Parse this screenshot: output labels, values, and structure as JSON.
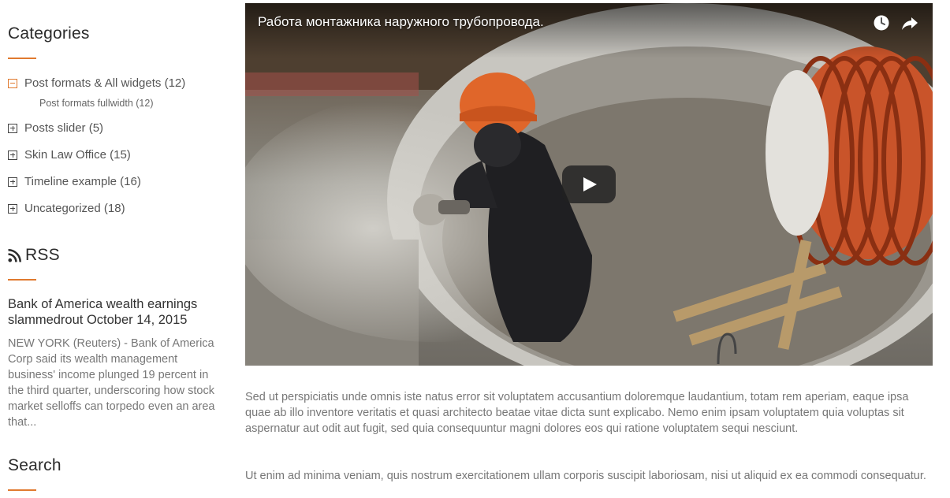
{
  "sidebar": {
    "categories": {
      "title": "Categories",
      "items": [
        {
          "label": "Post formats & All widgets (12)",
          "icon": "minus-box-icon"
        },
        {
          "label": "Posts slider (5)",
          "icon": "plus-box-icon"
        },
        {
          "label": "Skin Law Office (15)",
          "icon": "plus-box-icon"
        },
        {
          "label": "Timeline example (16)",
          "icon": "plus-box-icon"
        },
        {
          "label": "Uncategorized (18)",
          "icon": "plus-box-icon"
        }
      ],
      "subitem": "Post formats fullwidth (12)"
    },
    "rss": {
      "title": "RSS",
      "post_title": "Bank of America wealth earnings slammedrout October 14, 2015",
      "excerpt": "NEW YORK (Reuters) - Bank of America Corp said its wealth management business' income plunged 19 percent in the third quarter, underscoring how stock market selloffs can torpedo even an area that..."
    },
    "search": {
      "title": "Search"
    }
  },
  "video": {
    "title": "Работа монтажника наружного трубопровода.",
    "icons": [
      "clock-icon",
      "share-icon",
      "play-icon"
    ]
  },
  "content": {
    "paragraph_1": "Sed ut perspiciatis unde omnis iste natus error sit voluptatem accusantium doloremque laudantium, totam rem aperiam, eaque ipsa quae ab illo inventore veritatis et quasi architecto beatae vitae dicta sunt explicabo. Nemo enim ipsam voluptatem quia voluptas sit aspernatur aut odit aut fugit, sed quia consequuntur magni dolores eos qui ratione voluptatem sequi nesciunt.",
    "paragraph_2": "Ut enim ad minima veniam, quis nostrum exercitationem ullam corporis suscipit laboriosam, nisi ut aliquid ex ea commodi consequatur."
  },
  "colors": {
    "accent": "#e07a2f",
    "text": "#777777",
    "heading": "#2b2b2b"
  }
}
